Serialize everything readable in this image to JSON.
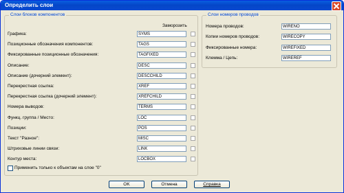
{
  "window": {
    "title": "Определить слои"
  },
  "left_frame": {
    "title": "Слои блоков компонентов",
    "freeze_header": "Заморозить",
    "rows": [
      {
        "label": "Графика:",
        "value": "SYMS"
      },
      {
        "label": "Позиционные обозначения компонентов:",
        "value": "TAGS"
      },
      {
        "label": "Фиксированные позиционные обозначения:",
        "value": "TAGFIXED"
      },
      {
        "label": "Описание:",
        "value": "DESC"
      },
      {
        "label": "Описание (дочерний элемент):",
        "value": "DESCCHILD"
      },
      {
        "label": "Перекрестная ссылка:",
        "value": "XREF"
      },
      {
        "label": "Перекрестная ссылка (дочерний элемент):",
        "value": "XREFCHILD"
      },
      {
        "label": "Номера выводов:",
        "value": "TERMS"
      },
      {
        "label": "Функц. группа / Место:",
        "value": "LOC"
      },
      {
        "label": "Позиции:",
        "value": "POS"
      },
      {
        "label": "Текст \"Разное\":",
        "value": "MISC"
      },
      {
        "label": "Штриховые линии связи:",
        "value": "LINK"
      },
      {
        "label": "Контур места:",
        "value": "LOCBOX"
      }
    ],
    "apply_label": "Применить только к объектам на слое \"0\""
  },
  "right_frame": {
    "title": "Слои номеров проводов",
    "rows": [
      {
        "label": "Номера проводов:",
        "value": "WIRENO"
      },
      {
        "label": "Копии номеров проводов:",
        "value": "WIRECOPY"
      },
      {
        "label": "Фиксированные номера:",
        "value": "WIREFIXED"
      },
      {
        "label": "Клемма / Цепь:",
        "value": "WIREREF"
      }
    ]
  },
  "buttons": {
    "ok": "OK",
    "cancel": "Отмена",
    "help": "Справка"
  }
}
